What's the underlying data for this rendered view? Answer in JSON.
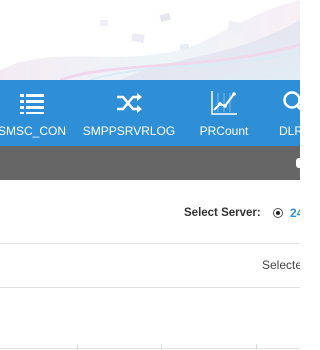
{
  "nav": {
    "items": [
      {
        "label": "SMSC_CON",
        "icon": "list-icon"
      },
      {
        "label": "SMPPSRVRLOG",
        "icon": "shuffle-icon"
      },
      {
        "label": "PRCount",
        "icon": "line-chart-icon"
      },
      {
        "label": "DLRS",
        "icon": "search-icon"
      }
    ]
  },
  "server": {
    "label": "Select Server:",
    "selected_value": "24"
  },
  "selection": {
    "text": "Selecte"
  },
  "colors": {
    "nav_bg": "#2e8fd6",
    "subbar_bg": "#666666",
    "accent": "#2e8fd6"
  }
}
